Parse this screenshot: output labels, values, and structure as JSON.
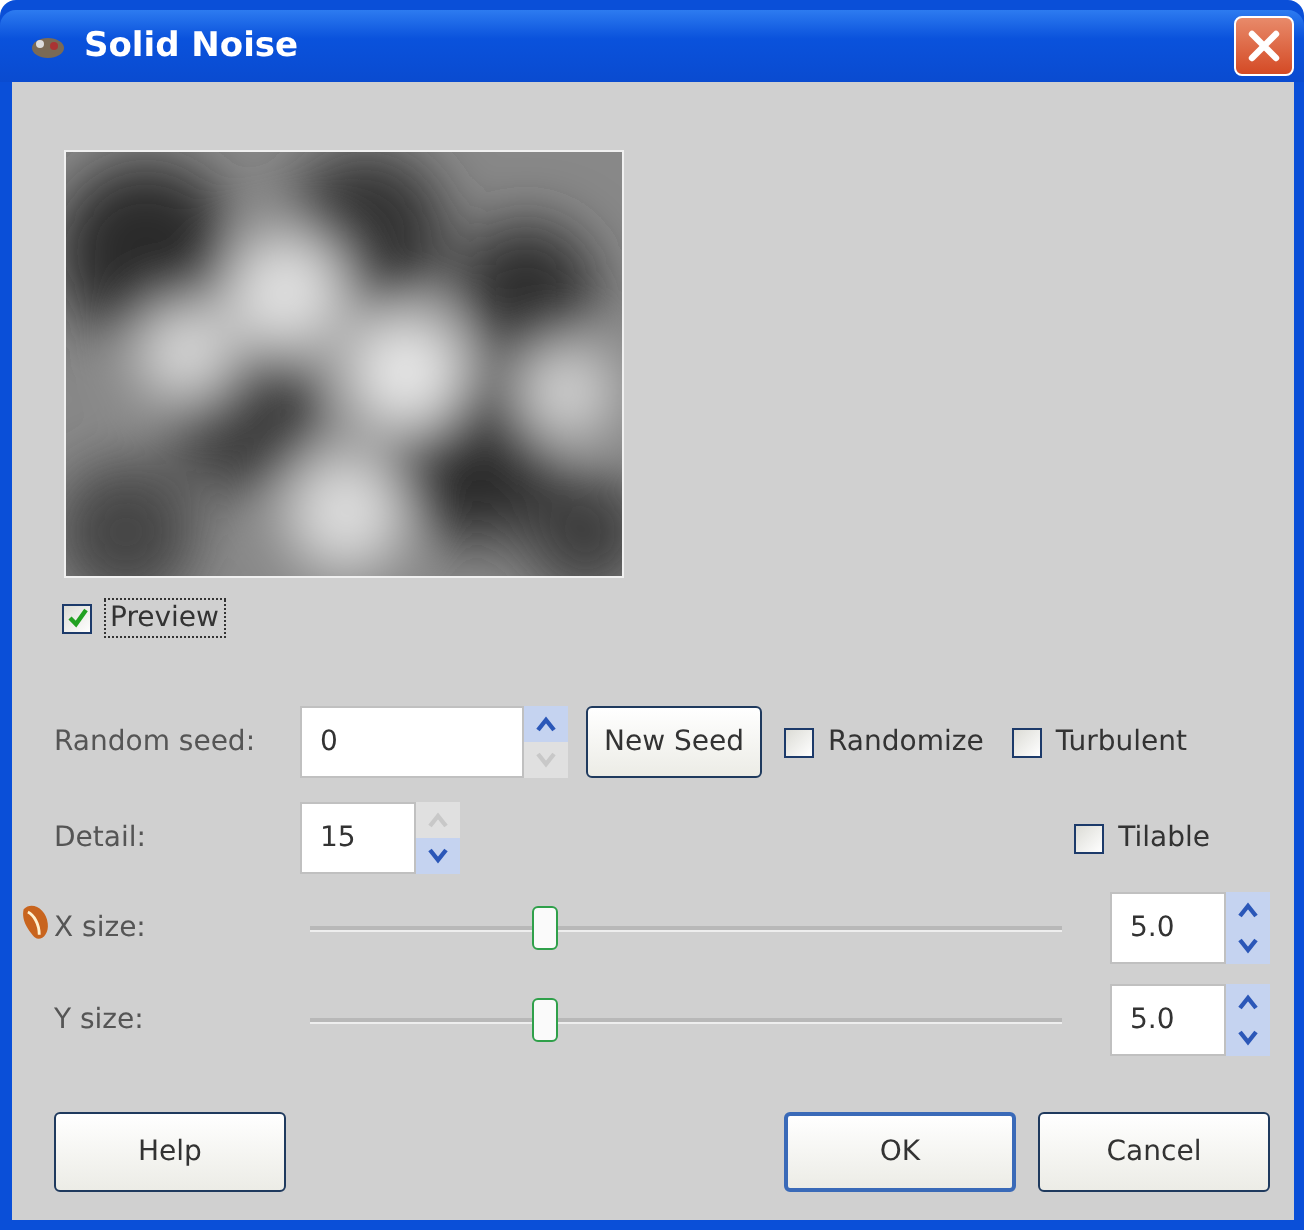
{
  "window": {
    "title": "Solid Noise"
  },
  "preview": {
    "label": "Preview",
    "checked": true
  },
  "random_seed": {
    "label": "Random seed:",
    "value": "0",
    "up_disabled": false,
    "down_disabled": true
  },
  "new_seed_button": {
    "label": "New Seed"
  },
  "options": [
    {
      "label": "Randomize",
      "checked": false
    },
    {
      "label": "Turbulent",
      "checked": false
    },
    {
      "label": "Tilable",
      "checked": false
    }
  ],
  "detail": {
    "label": "Detail:",
    "value": "15",
    "up_disabled": true,
    "down_disabled": false
  },
  "sliders": [
    {
      "label": "X size:",
      "level": 0.31,
      "value": "5.0"
    },
    {
      "label": "Y size:",
      "level": 0.31,
      "value": "5.0"
    }
  ],
  "buttons": [
    {
      "label": "Help",
      "default": false
    },
    {
      "label": "OK",
      "default": true
    },
    {
      "label": "Cancel",
      "default": false
    }
  ]
}
